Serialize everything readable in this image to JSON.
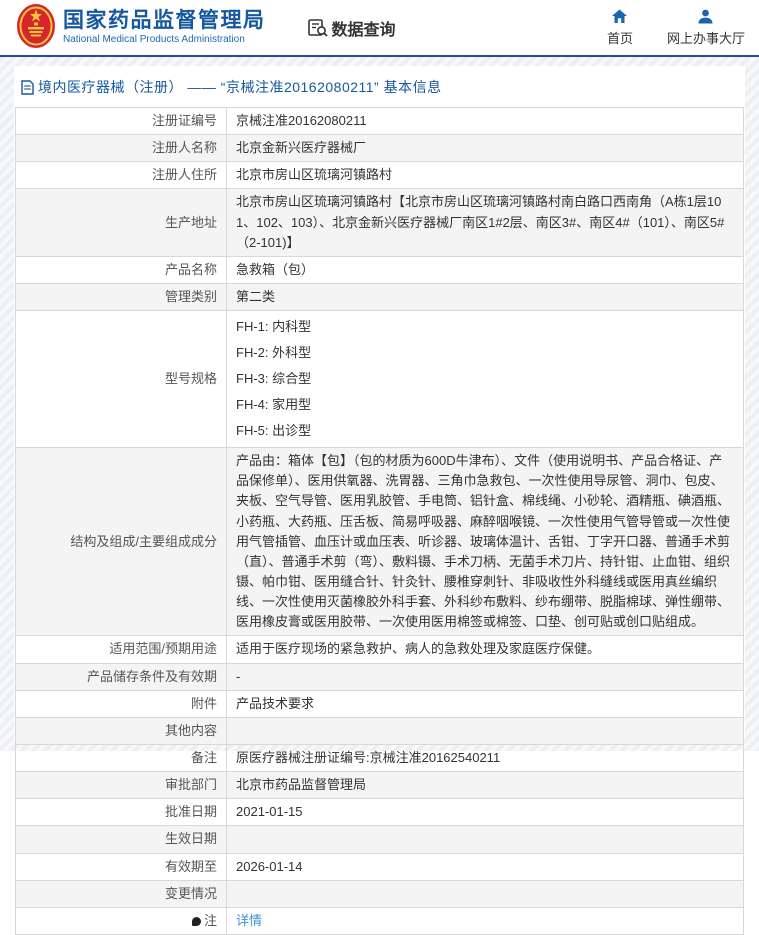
{
  "header": {
    "brand_cn": "国家药品监督管理局",
    "brand_en": "National Medical Products Administration",
    "data_query_label": "数据查询",
    "nav_home": "首页",
    "nav_hall": "网上办事大厅"
  },
  "breadcrumb": "境内医疗器械（注册） —— “京械注准20162080211” 基本信息",
  "table": {
    "rows": [
      {
        "label": "注册证编号",
        "value": "京械注准20162080211"
      },
      {
        "label": "注册人名称",
        "value": "北京金新兴医疗器械厂"
      },
      {
        "label": "注册人住所",
        "value": "北京市房山区琉璃河镇路村"
      },
      {
        "label": "生产地址",
        "value": "北京市房山区琉璃河镇路村【北京市房山区琉璃河镇路村南白路口西南角（A栋1层101、102、103）、北京金新兴医疗器械厂南区1#2层、南区3#、南区4#（101）、南区5#（2-101)】"
      },
      {
        "label": "产品名称",
        "value": "急救箱（包）"
      },
      {
        "label": "管理类别",
        "value": "第二类"
      },
      {
        "label": "型号规格",
        "type": "lines",
        "value_lines": [
          "FH-1: 内科型",
          "FH-2: 外科型",
          "FH-3: 综合型",
          "FH-4: 家用型",
          "FH-5: 出诊型"
        ]
      },
      {
        "label": "结构及组成/主要组成成分",
        "value": "产品由：箱体【包】（包的材质为600D牛津布）、文件（使用说明书、产品合格证、产品保修单）、医用供氧器、洗胃器、三角巾急救包、一次性使用导尿管、洞巾、包皮、夹板、空气导管、医用乳胶管、手电筒、铝针盒、棉线绳、小砂轮、酒精瓶、碘酒瓶、小药瓶、大药瓶、压舌板、简易呼吸器、麻醉咽喉镜、一次性使用气管导管或一次性使用气管插管、血压计或血压表、听诊器、玻璃体温计、舌钳、丁字开口器、普通手术剪（直）、普通手术剪（弯）、敷料镊、手术刀柄、无菌手术刀片、持针钳、止血钳、组织镊、帕巾钳、医用缝合针、针灸针、腰椎穿刺针、非吸收性外科缝线或医用真丝编织线、一次性使用灭菌橡胶外科手套、外科纱布敷料、纱布绷带、脱脂棉球、弹性绷带、医用橡皮膏或医用胶带、一次使用医用棉签或棉签、口垫、创可贴或创口贴组成。"
      },
      {
        "label": "适用范围/预期用途",
        "value": "适用于医疗现场的紧急救护、病人的急救处理及家庭医疗保健。"
      },
      {
        "label": "产品储存条件及有效期",
        "value": "-"
      },
      {
        "label": "附件",
        "value": "产品技术要求"
      },
      {
        "label": "其他内容",
        "value": ""
      },
      {
        "label": "备注",
        "value": "原医疗器械注册证编号:京械注准20162540211"
      },
      {
        "label": "审批部门",
        "value": "北京市药品监督管理局"
      },
      {
        "label": "批准日期",
        "value": "2021-01-15"
      },
      {
        "label": "生效日期",
        "value": ""
      },
      {
        "label": "有效期至",
        "value": "2026-01-14"
      },
      {
        "label": "变更情况",
        "value": ""
      },
      {
        "label": "注",
        "label_icon": "note-icon",
        "type": "link",
        "value": "详情"
      }
    ]
  },
  "colors": {
    "brand_blue": "#1658a0",
    "header_rule_blue": "#1d4f9c",
    "link_blue": "#3d8fde",
    "row_stripe": "#f4f4f4",
    "table_border": "#d8d8d8"
  }
}
